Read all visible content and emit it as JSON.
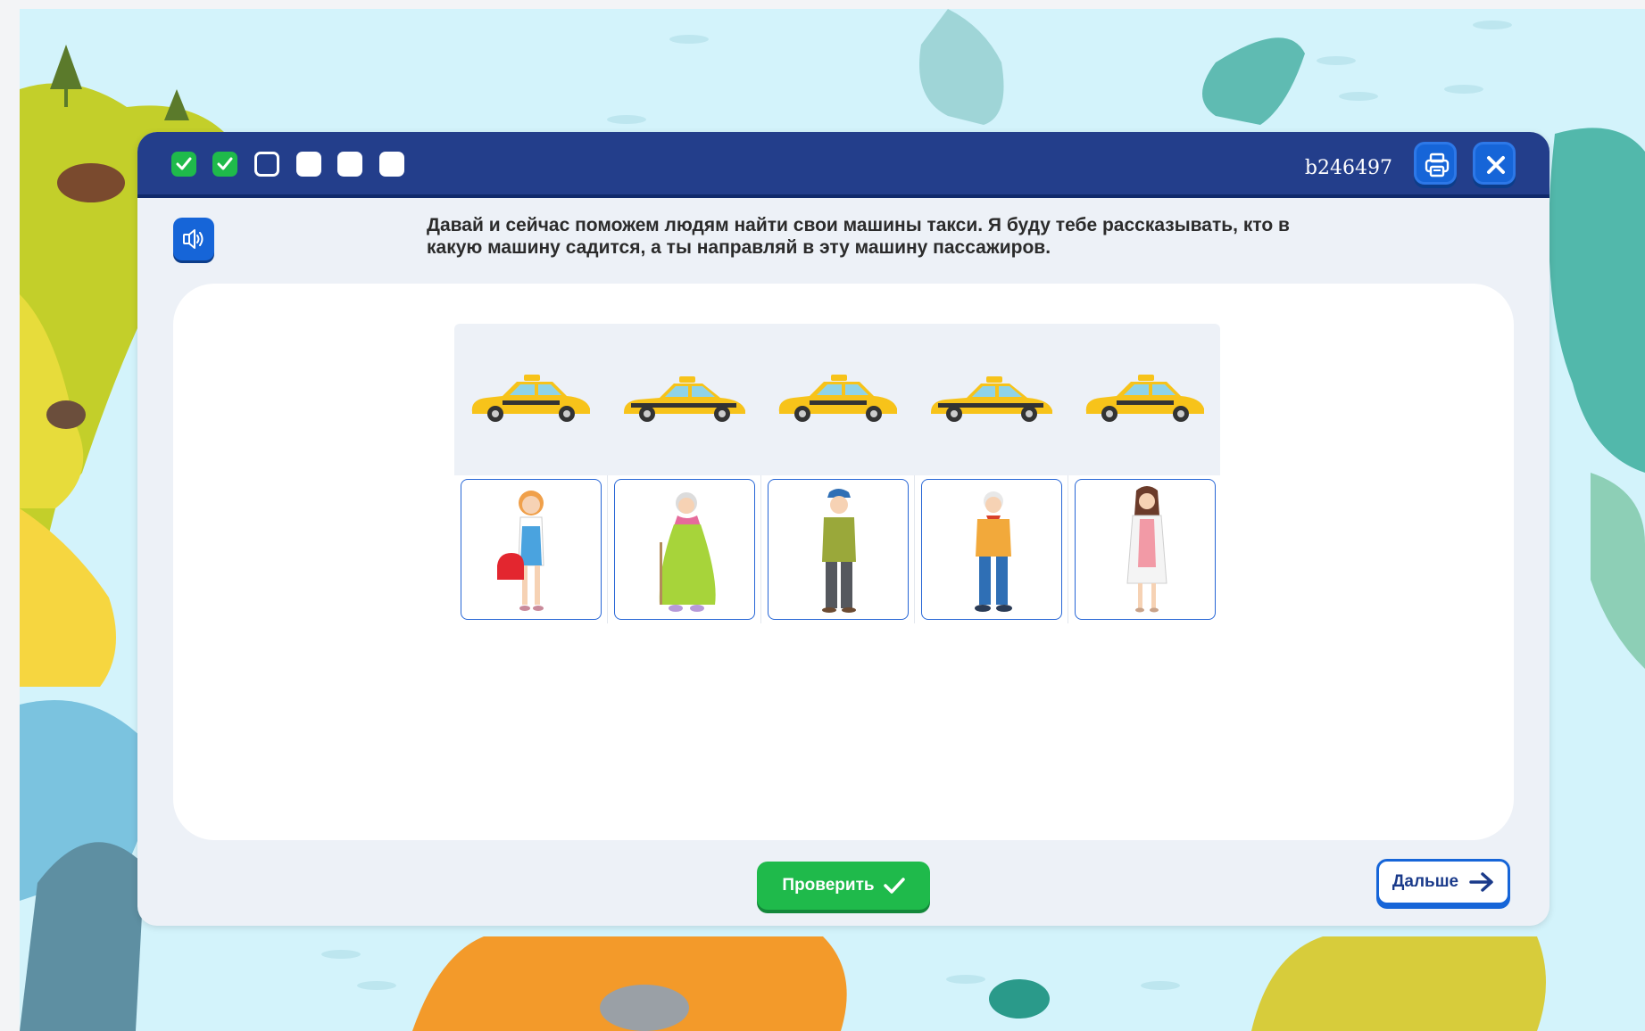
{
  "header": {
    "task_id": "b246497",
    "progress": [
      {
        "state": "done",
        "icon": "check-icon"
      },
      {
        "state": "done",
        "icon": "check-icon"
      },
      {
        "state": "current"
      },
      {
        "state": "todo"
      },
      {
        "state": "todo"
      },
      {
        "state": "todo"
      }
    ],
    "print_icon": "printer-icon",
    "close_icon": "close-icon"
  },
  "task": {
    "sound_icon": "speaker-icon",
    "instruction": "Давай и сейчас поможем людям найти свои машины такси. Я буду тебе рассказывать, кто в какую машину садится, а ты направляй в эту машину пассажиров."
  },
  "board": {
    "taxis": [
      "taxi-1",
      "taxi-2",
      "taxi-3",
      "taxi-4",
      "taxi-5"
    ],
    "passengers": [
      {
        "name": "girl-with-red-bag"
      },
      {
        "name": "grandmother-in-green-dress"
      },
      {
        "name": "man-in-cap"
      },
      {
        "name": "grandfather-in-jeans"
      },
      {
        "name": "woman-in-white-coat"
      }
    ]
  },
  "footer": {
    "check_label": "Проверить",
    "next_label": "Дальше"
  },
  "colors": {
    "header": "#233e8b",
    "accent_blue": "#1665d8",
    "success_green": "#1fba4b",
    "taxi_yellow": "#f7c31a",
    "background_sky": "#d3f3fb"
  }
}
